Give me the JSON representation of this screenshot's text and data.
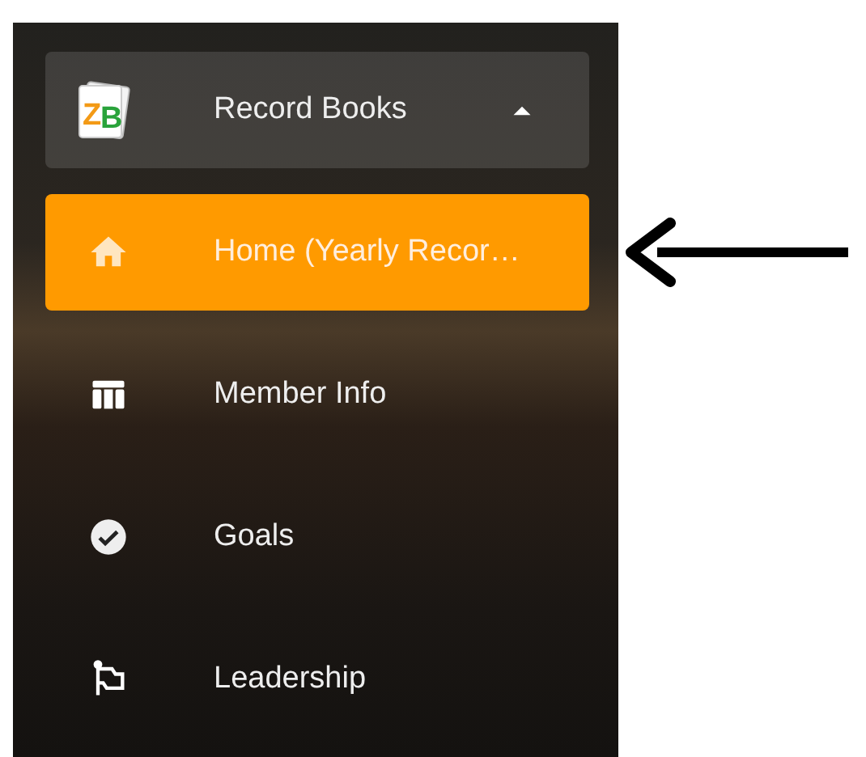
{
  "header": {
    "logo": "ZB",
    "title": "Record Books",
    "expanded": true
  },
  "items": [
    {
      "label": "Home (Yearly Recor…",
      "kind": "home",
      "selected": true
    },
    {
      "label": "Member Info",
      "kind": "table",
      "selected": false
    },
    {
      "label": "Goals",
      "kind": "check",
      "selected": false
    },
    {
      "label": "Leadership",
      "kind": "flag",
      "selected": false
    }
  ]
}
